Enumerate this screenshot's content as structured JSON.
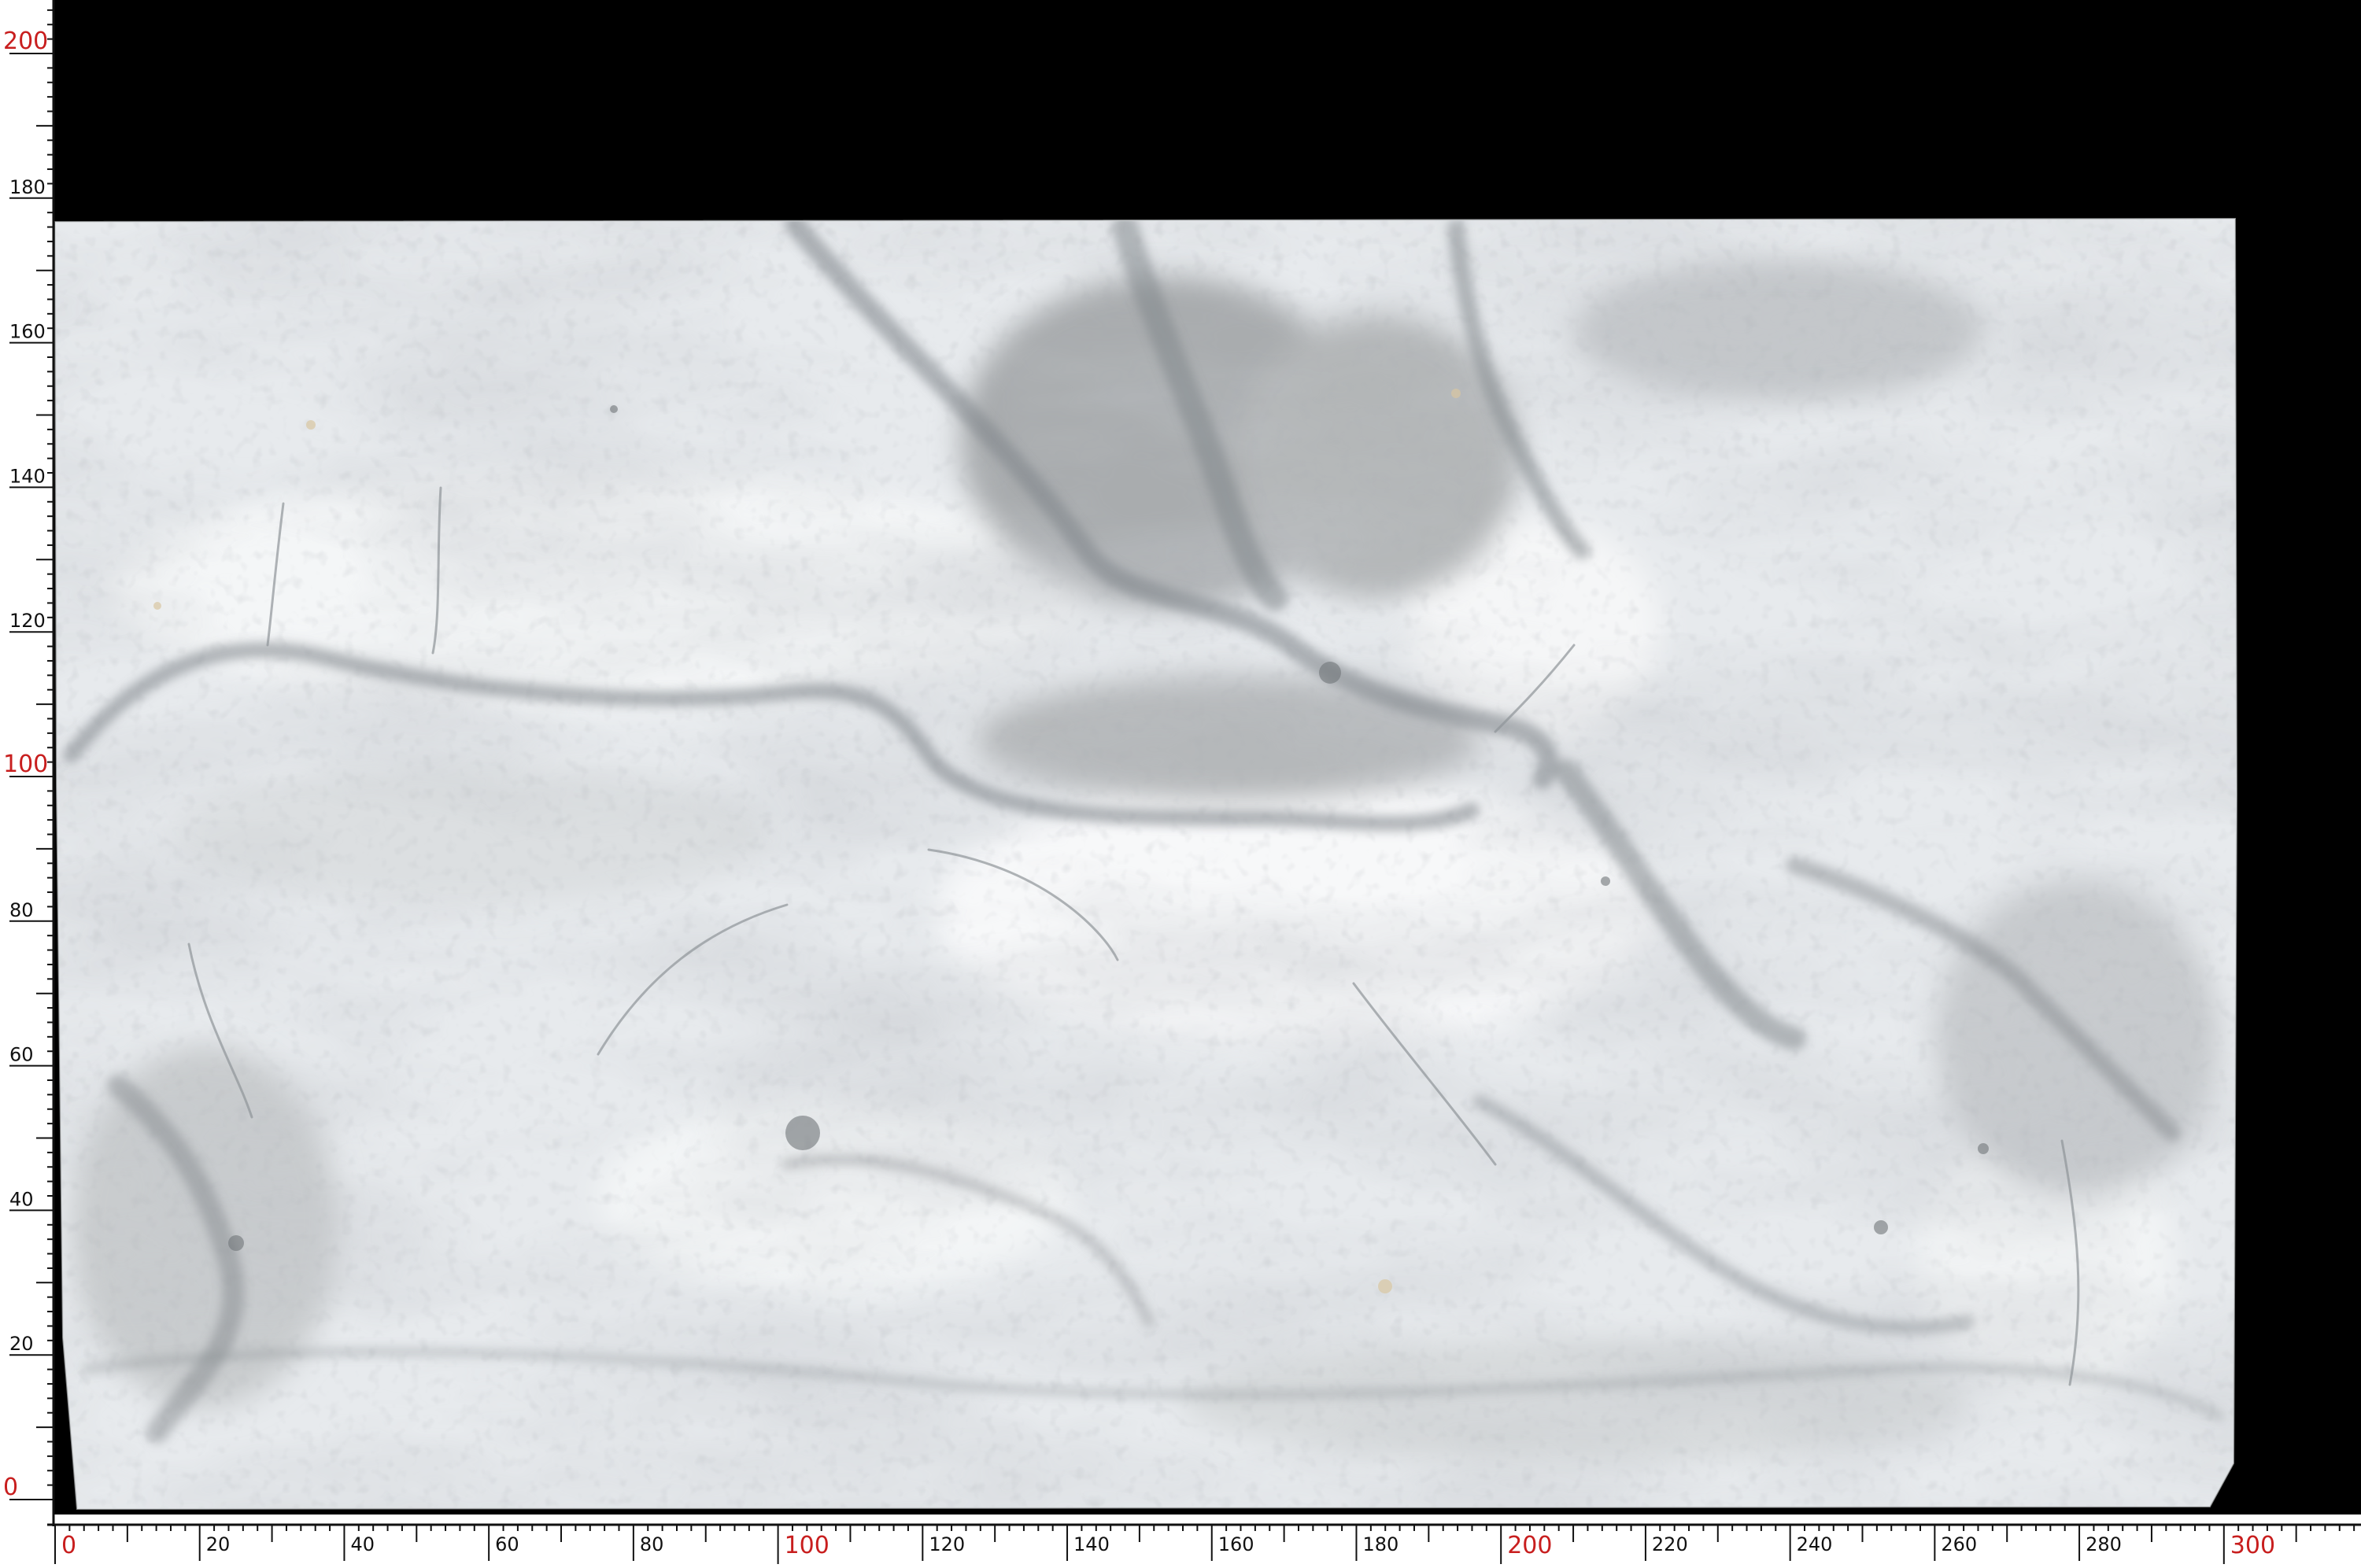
{
  "image": {
    "subject": "marble slab on black background with measuring rulers",
    "background_color": "#000000",
    "slab_base_color": "#e6e9ec",
    "vein_color": "#8a8f93",
    "accent_major_label_color": "#c81e1e",
    "minor_label_color": "#111111"
  },
  "x_ruler": {
    "min": 0,
    "max": 320,
    "label_step": 20,
    "major_step": 100,
    "labels": [
      "0",
      "20",
      "40",
      "60",
      "80",
      "100",
      "120",
      "140",
      "160",
      "180",
      "200",
      "220",
      "240",
      "260",
      "280",
      "300"
    ]
  },
  "y_ruler": {
    "min": 0,
    "max": 210,
    "label_step": 20,
    "major_step": 100,
    "labels": [
      "0",
      "20",
      "40",
      "60",
      "80",
      "100",
      "120",
      "140",
      "160",
      "180",
      "200"
    ]
  },
  "slab": {
    "width_cm": 302,
    "height_cm": 178
  }
}
